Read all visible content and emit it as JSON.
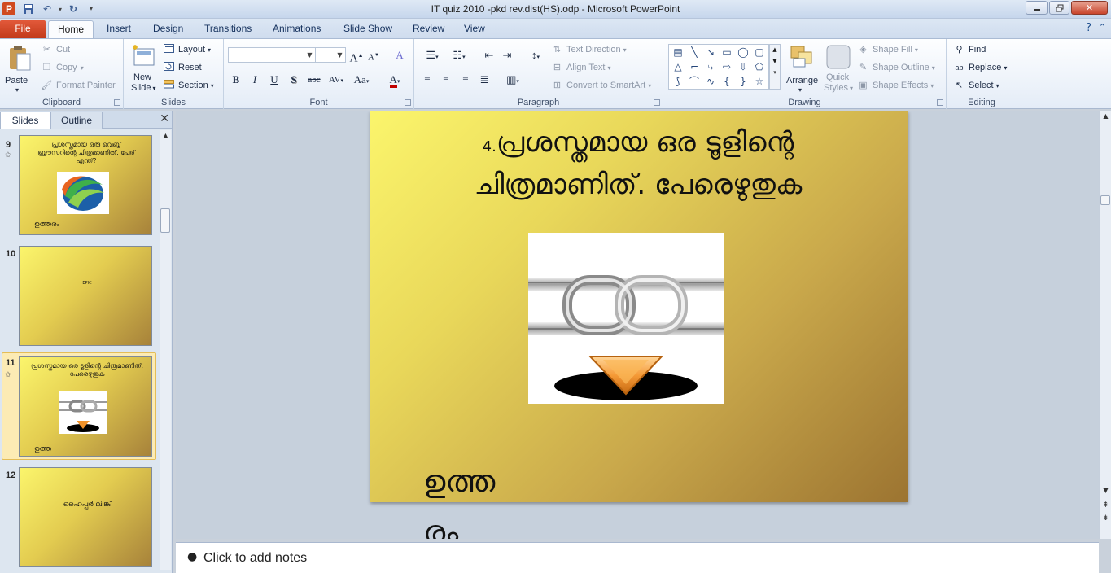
{
  "window": {
    "title": "IT quiz 2010 -pkd rev.dist(HS).odp  -  Microsoft PowerPoint",
    "app_logo": "P"
  },
  "tabs": [
    "File",
    "Home",
    "Insert",
    "Design",
    "Transitions",
    "Animations",
    "Slide Show",
    "Review",
    "View"
  ],
  "ribbon": {
    "clipboard": {
      "paste": "Paste",
      "cut": "Cut",
      "copy": "Copy",
      "format_painter": "Format Painter",
      "label": "Clipboard"
    },
    "slides": {
      "new_slide_line1": "New",
      "new_slide_line2": "Slide",
      "layout": "Layout",
      "reset": "Reset",
      "section": "Section",
      "label": "Slides"
    },
    "font": {
      "label": "Font",
      "bold": "B",
      "italic": "I",
      "underline": "U",
      "shadow": "S",
      "strike": "abc",
      "grow": "A",
      "shrink": "A",
      "case": "Aa",
      "color": "A",
      "clear": "A"
    },
    "paragraph": {
      "label": "Paragraph",
      "text_direction": "Text Direction",
      "align_text": "Align Text",
      "convert_smartart": "Convert to SmartArt"
    },
    "drawing": {
      "label": "Drawing",
      "arrange": "Arrange",
      "quick_styles_line1": "Quick",
      "quick_styles_line2": "Styles",
      "shape_fill": "Shape Fill",
      "shape_outline": "Shape Outline",
      "shape_effects": "Shape Effects"
    },
    "editing": {
      "label": "Editing",
      "find": "Find",
      "replace": "Replace",
      "select": "Select"
    }
  },
  "panel": {
    "tab_slides": "Slides",
    "tab_outline": "Outline",
    "thumbnails": [
      {
        "number": "9",
        "title": "പ്രശസ്തമായ ഒരു വെബ്ബ് ബ്രൗസറിന്റെ ചിത്രമാണിത്. പേര് എന്ത്?",
        "foot": "ഉത്തരം",
        "has_star": true
      },
      {
        "number": "10",
        "title": "EPIC",
        "foot": "",
        "has_star": false
      },
      {
        "number": "11",
        "title": "പ്രശസ്തമായ ഒര ടൂളിന്റെ ചിത്രമാണിത്. പേരെഴുതുക",
        "foot": "ഉത്ത",
        "has_star": true
      },
      {
        "number": "12",
        "title": "ഹൈപ്പർ ലിങ്ക്",
        "foot": "",
        "has_star": false
      }
    ]
  },
  "slide": {
    "number_prefix": "4.",
    "title_line1": "പ്രശസ്തമായ ഒര ടൂളിന്റെ",
    "title_line2": "ചിത്രമാണിത്. പേരെഴുതുക",
    "answer_line1": "ഉത്ത",
    "answer_line2": "രം"
  },
  "notes": {
    "placeholder": "Click to add notes"
  },
  "colors": {
    "file_tab": "#c9401e",
    "slide_gradient_start": "#fbf56c",
    "slide_gradient_end": "#9c7431",
    "selected_thumb": "#fcebb4"
  }
}
